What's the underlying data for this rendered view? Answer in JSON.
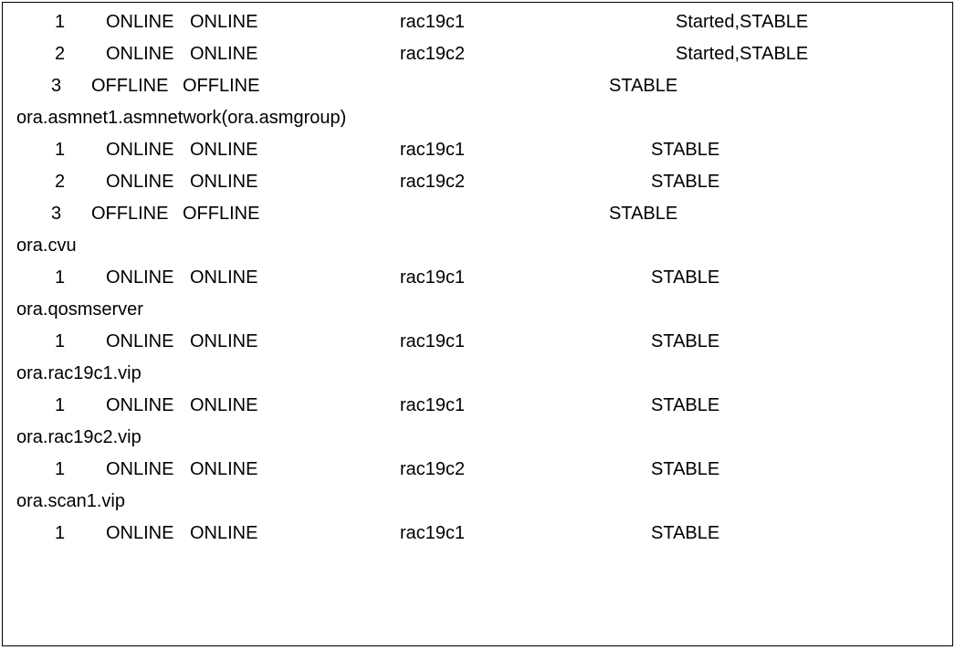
{
  "groups": [
    {
      "label": "",
      "rows": [
        {
          "num": "1",
          "target": "ONLINE",
          "state": "ONLINE",
          "server": "rac19c1",
          "details": "Started,STABLE",
          "detailsClass": "started"
        },
        {
          "num": "2",
          "target": "ONLINE",
          "state": "ONLINE",
          "server": "rac19c2",
          "details": "Started,STABLE",
          "detailsClass": "started"
        },
        {
          "num": "3",
          "target": "OFFLINE",
          "state": "OFFLINE",
          "server": "",
          "details": "STABLE",
          "detailsClass": "offline-stable",
          "offline": true
        }
      ]
    },
    {
      "label": "ora.asmnet1.asmnetwork(ora.asmgroup)",
      "rows": [
        {
          "num": "1",
          "target": "ONLINE",
          "state": "ONLINE",
          "server": "rac19c1",
          "details": "STABLE",
          "detailsClass": ""
        },
        {
          "num": "2",
          "target": "ONLINE",
          "state": "ONLINE",
          "server": "rac19c2",
          "details": "STABLE",
          "detailsClass": ""
        },
        {
          "num": "3",
          "target": "OFFLINE",
          "state": "OFFLINE",
          "server": "",
          "details": "STABLE",
          "detailsClass": "offline-stable",
          "offline": true
        }
      ]
    },
    {
      "label": "ora.cvu",
      "rows": [
        {
          "num": "1",
          "target": "ONLINE",
          "state": "ONLINE",
          "server": "rac19c1",
          "details": "STABLE",
          "detailsClass": ""
        }
      ]
    },
    {
      "label": "ora.qosmserver",
      "rows": [
        {
          "num": "1",
          "target": "ONLINE",
          "state": "ONLINE",
          "server": "rac19c1",
          "details": "STABLE",
          "detailsClass": ""
        }
      ]
    },
    {
      "label": "ora.rac19c1.vip",
      "rows": [
        {
          "num": "1",
          "target": "ONLINE",
          "state": "ONLINE",
          "server": "rac19c1",
          "details": "STABLE",
          "detailsClass": ""
        }
      ]
    },
    {
      "label": "ora.rac19c2.vip",
      "rows": [
        {
          "num": "1",
          "target": "ONLINE",
          "state": "ONLINE",
          "server": "rac19c2",
          "details": "STABLE",
          "detailsClass": ""
        }
      ]
    },
    {
      "label": "ora.scan1.vip",
      "rows": [
        {
          "num": "1",
          "target": "ONLINE",
          "state": "ONLINE",
          "server": "rac19c1",
          "details": "STABLE",
          "detailsClass": ""
        }
      ]
    }
  ]
}
